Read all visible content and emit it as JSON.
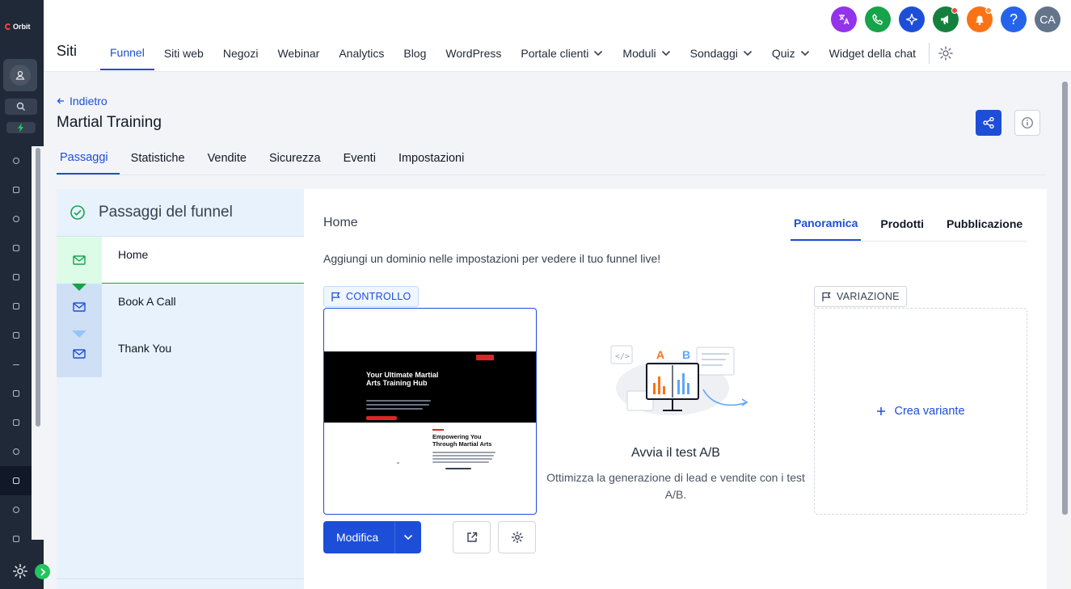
{
  "brand": {
    "logo_text": "Orbit"
  },
  "header": {
    "section_title": "Siti",
    "nav": [
      {
        "label": "Funnel",
        "active": true,
        "dropdown": false
      },
      {
        "label": "Siti web",
        "dropdown": false
      },
      {
        "label": "Negozi",
        "dropdown": false
      },
      {
        "label": "Webinar",
        "dropdown": false
      },
      {
        "label": "Analytics",
        "dropdown": false
      },
      {
        "label": "Blog",
        "dropdown": false
      },
      {
        "label": "WordPress",
        "dropdown": false
      },
      {
        "label": "Portale clienti",
        "dropdown": true
      },
      {
        "label": "Moduli",
        "dropdown": true
      },
      {
        "label": "Sondaggi",
        "dropdown": true
      },
      {
        "label": "Quiz",
        "dropdown": true
      },
      {
        "label": "Widget della chat",
        "dropdown": false
      }
    ],
    "top_icons": [
      {
        "name": "translate-icon",
        "color": "#9333ea"
      },
      {
        "name": "phone-icon",
        "color": "#16a34a"
      },
      {
        "name": "ai-sparkle-icon",
        "color": "#1d4ed8"
      },
      {
        "name": "megaphone-icon",
        "color": "#15803d",
        "badge": true
      },
      {
        "name": "bell-icon",
        "color": "#f97316",
        "badge": true
      },
      {
        "name": "help-icon",
        "color": "#2563eb",
        "text": "?"
      },
      {
        "name": "user-avatar",
        "color": "#64748b",
        "text": "CA"
      }
    ]
  },
  "page": {
    "back_label": "Indietro",
    "title": "Martial Training",
    "tabs": [
      "Passaggi",
      "Statistiche",
      "Vendite",
      "Sicurezza",
      "Eventi",
      "Impostazioni"
    ]
  },
  "steps": {
    "heading": "Passaggi del funnel",
    "items": [
      {
        "label": "Home"
      },
      {
        "label": "Book A Call"
      },
      {
        "label": "Thank You"
      }
    ]
  },
  "card": {
    "title": "Home",
    "tabs": [
      "Panoramica",
      "Prodotti",
      "Pubblicazione"
    ],
    "notice": "Aggiungi un dominio nelle impostazioni per vedere il tuo funnel live!",
    "control_tag": "CONTROLLO",
    "variant_tag": "VARIAZIONE",
    "preview": {
      "hero_title": "Your Ultimate Martial Arts Training Hub",
      "section_title": "Empowering You Through Martial Arts"
    },
    "edit_label": "Modifica",
    "ab_title": "Avvia il test A/B",
    "ab_desc": "Ottimizza la generazione di lead e vendite con i test A/B.",
    "ab_letters": [
      "A",
      "B"
    ],
    "create_variant": "Crea variante"
  },
  "colors": {
    "accent": "#1d4ed8",
    "success": "#16a34a",
    "sidebar_bg": "#1f2937",
    "steps_bg": "#e8f2fd"
  }
}
